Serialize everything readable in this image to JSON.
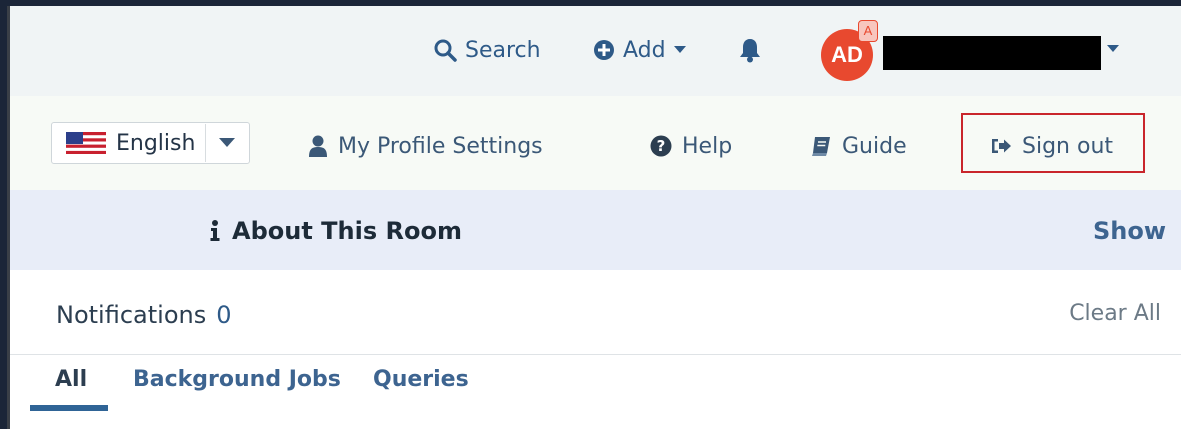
{
  "topbar": {
    "search_label": "Search",
    "add_label": "Add",
    "avatar_initials": "AD",
    "avatar_badge": "A",
    "icons": [
      "search-icon",
      "plus-circle-icon",
      "caret-down-icon",
      "bell-icon"
    ]
  },
  "secondbar": {
    "language": "English",
    "profile_label": "My Profile Settings",
    "help_label": "Help",
    "guide_label": "Guide",
    "signout_label": "Sign out"
  },
  "about": {
    "title": "About This Room",
    "show_label": "Show"
  },
  "notifications": {
    "title": "Notifications",
    "count": "0",
    "clear_label": "Clear All",
    "tabs": [
      {
        "label": "All"
      },
      {
        "label": "Background Jobs"
      },
      {
        "label": "Queries"
      }
    ]
  },
  "colors": {
    "accent": "#2e5a88",
    "avatar": "#e8492f",
    "highlight_border": "#c9252c",
    "about_bg": "#e8edf8"
  }
}
